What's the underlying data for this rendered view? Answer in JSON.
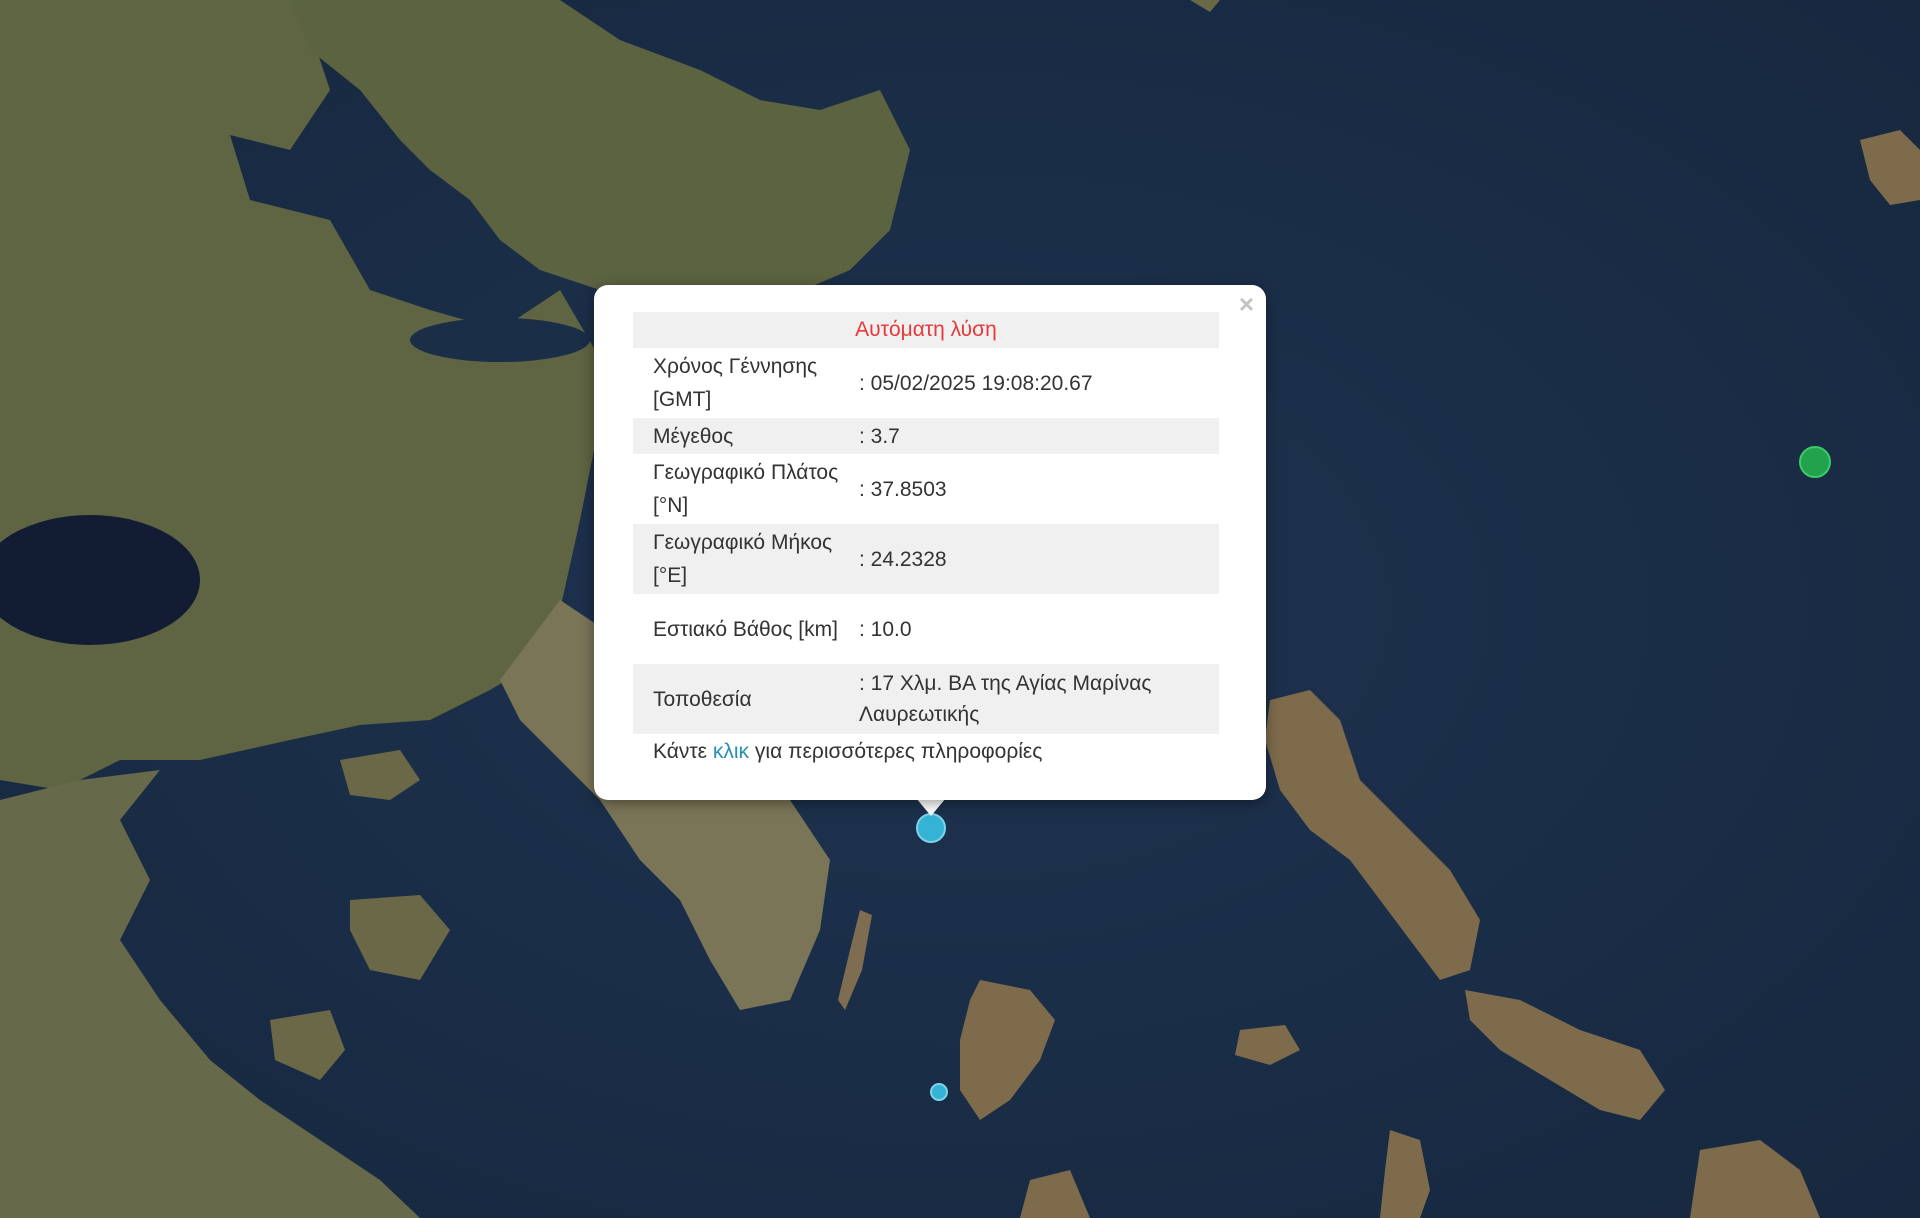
{
  "popup": {
    "title": "Αυτόματη λύση",
    "close_icon": "close-icon",
    "rows": [
      {
        "label": "Χρόνος Γέννησης [GMT]",
        "value": ": 05/02/2025 19:08:20.67"
      },
      {
        "label": "Μέγεθος",
        "value": ": 3.7"
      },
      {
        "label": "Γεωγραφικό Πλάτος [°N]",
        "value": ": 37.8503"
      },
      {
        "label": "Γεωγραφικό Μήκος [°E]",
        "value": ": 24.2328"
      },
      {
        "label": "Εστιακό Βάθος [km]",
        "value": ": 10.0"
      },
      {
        "label": "Τοποθεσία",
        "value": ": 17 Χλμ. ΒΑ της Αγίας Μαρίνας Λαυρεωτικής"
      }
    ],
    "more_prefix": "Κάντε ",
    "more_link": "κλικ",
    "more_suffix": " για περισσότερες πληροφορίες"
  },
  "colors": {
    "title": "#e8393a",
    "link": "#2a8fb5",
    "marker_blue": "#35b3d4",
    "marker_green": "#23a24d",
    "sea": "#1b2d45",
    "land": "#6b6a48"
  },
  "markers": [
    {
      "name": "earthquake-marker-selected",
      "color": "blue"
    },
    {
      "name": "earthquake-marker-small",
      "color": "blue"
    },
    {
      "name": "earthquake-marker-green",
      "color": "green"
    }
  ]
}
